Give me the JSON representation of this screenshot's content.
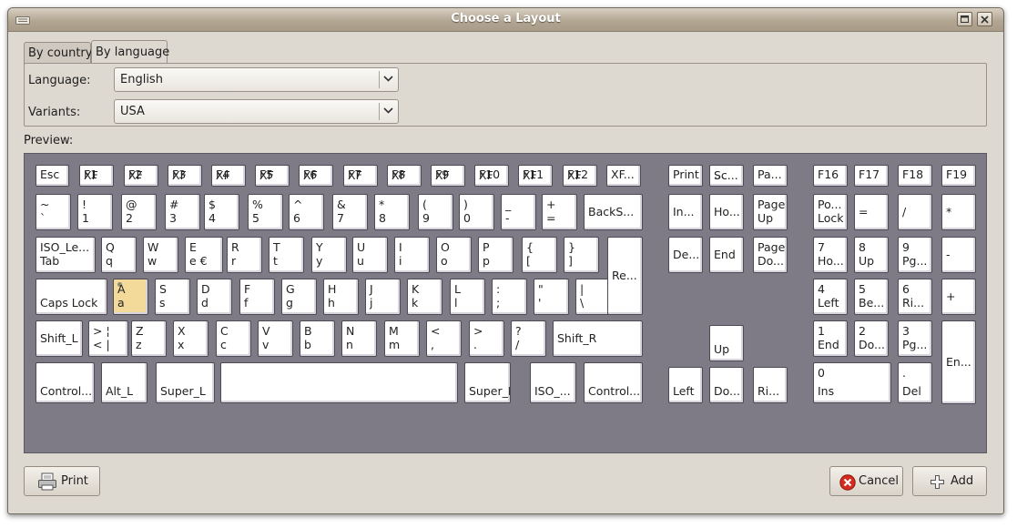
{
  "window": {
    "title": "Choose a Layout"
  },
  "tabs": [
    "By country",
    "By language"
  ],
  "form": {
    "language_label": "Language:",
    "language_value": "English",
    "variants_label": "Variants:",
    "variants_value": "USA"
  },
  "preview_label": "Preview:",
  "buttons": {
    "print": "Print",
    "cancel": "Cancel",
    "add": "Add"
  },
  "keyboard": {
    "keys": [
      {
        "t": "",
        "b": "Esc"
      },
      {
        "t": "XF",
        "b": "F1"
      },
      {
        "t": "XF",
        "b": "F2"
      },
      {
        "t": "XF",
        "b": "F3"
      },
      {
        "t": "XF",
        "b": "F4"
      },
      {
        "t": "XF",
        "b": "F5"
      },
      {
        "t": "XF",
        "b": "F6"
      },
      {
        "t": "XF",
        "b": "F7"
      },
      {
        "t": "XF",
        "b": "F8"
      },
      {
        "t": "XF",
        "b": "F9"
      },
      {
        "t": "XF",
        "b": "F10"
      },
      {
        "t": "XF",
        "b": "F11"
      },
      {
        "t": "XF",
        "b": "F12"
      },
      {
        "t": "",
        "b": "XF..."
      },
      {
        "t": "",
        "b": "Print"
      },
      {
        "t": "Sc...",
        "b": "..."
      },
      {
        "t": "",
        "b": "Pa..."
      },
      {
        "t": "",
        "b": "F16"
      },
      {
        "t": "",
        "b": "F17"
      },
      {
        "t": "",
        "b": "F18"
      },
      {
        "t": "",
        "b": "F19"
      },
      {
        "t": "~",
        "b": "`"
      },
      {
        "t": "!",
        "b": "1"
      },
      {
        "t": "@",
        "b": "2"
      },
      {
        "t": "#",
        "b": "3"
      },
      {
        "t": "$",
        "b": "4"
      },
      {
        "t": "%",
        "b": "5"
      },
      {
        "t": "^",
        "b": "6"
      },
      {
        "t": "&",
        "b": "7"
      },
      {
        "t": "*",
        "b": "8"
      },
      {
        "t": "(",
        "b": "9"
      },
      {
        "t": ")",
        "b": "0"
      },
      {
        "t": "_",
        "b": "-"
      },
      {
        "t": "+",
        "b": "="
      },
      {
        "t": "",
        "m": "BackS..."
      },
      {
        "t": "",
        "m": "In..."
      },
      {
        "t": "",
        "m": "Ho..."
      },
      {
        "t": "Page",
        "b": "Up"
      },
      {
        "t": "Po...",
        "b": "Lock"
      },
      {
        "t": "",
        "m": "="
      },
      {
        "t": "",
        "m": "/"
      },
      {
        "t": "",
        "m": "*"
      },
      {
        "t": "ISO_Le...",
        "b": "Tab"
      },
      {
        "t": "Q",
        "b": "q"
      },
      {
        "t": "W",
        "b": "w"
      },
      {
        "t": "E",
        "b": "e  €"
      },
      {
        "t": "R",
        "b": "r"
      },
      {
        "t": "T",
        "b": "t"
      },
      {
        "t": "Y",
        "b": "y"
      },
      {
        "t": "U",
        "b": "u"
      },
      {
        "t": "I",
        "b": "i"
      },
      {
        "t": "O",
        "b": "o"
      },
      {
        "t": "P",
        "b": "p"
      },
      {
        "t": "{",
        "b": "["
      },
      {
        "t": "}",
        "b": "]"
      },
      {
        "t": "",
        "m": "De..."
      },
      {
        "t": "",
        "m": "End"
      },
      {
        "t": "Page",
        "b": "Do..."
      },
      {
        "t": "7",
        "b": "Ho..."
      },
      {
        "t": "8",
        "b": "Up"
      },
      {
        "t": "9",
        "b": "Pg..."
      },
      {
        "t": "",
        "m": "-"
      },
      {
        "t": "",
        "b": "Caps Lock"
      },
      {
        "t": "A",
        "b": "a"
      },
      {
        "t": "S",
        "b": "s"
      },
      {
        "t": "D",
        "b": "d"
      },
      {
        "t": "F",
        "b": "f"
      },
      {
        "t": "G",
        "b": "g"
      },
      {
        "t": "H",
        "b": "h"
      },
      {
        "t": "J",
        "b": "j"
      },
      {
        "t": "K",
        "b": "k"
      },
      {
        "t": "L",
        "b": "l"
      },
      {
        "t": ":",
        "b": ";"
      },
      {
        "t": "\"",
        "b": "'"
      },
      {
        "t": "|",
        "b": "\\"
      },
      {
        "t": "",
        "m": "Re..."
      },
      {
        "t": "4",
        "b": "Left"
      },
      {
        "t": "5",
        "b": "Be..."
      },
      {
        "t": "6",
        "b": "Ri..."
      },
      {
        "t": "",
        "m": "+"
      },
      {
        "t": "",
        "m": "Shift_L"
      },
      {
        "t": ">  ¦",
        "b": "<  |"
      },
      {
        "t": "Z",
        "b": "z"
      },
      {
        "t": "X",
        "b": "x"
      },
      {
        "t": "C",
        "b": "c"
      },
      {
        "t": "V",
        "b": "v"
      },
      {
        "t": "B",
        "b": "b"
      },
      {
        "t": "N",
        "b": "n"
      },
      {
        "t": "M",
        "b": "m"
      },
      {
        "t": "<",
        "b": ","
      },
      {
        "t": ">",
        "b": "."
      },
      {
        "t": "?",
        "b": "/"
      },
      {
        "t": "",
        "m": "Shift_R"
      },
      {
        "t": "",
        "b": "Up"
      },
      {
        "t": "1",
        "b": "End"
      },
      {
        "t": "2",
        "b": "Do..."
      },
      {
        "t": "3",
        "b": "Pg..."
      },
      {
        "t": "",
        "m": "En..."
      },
      {
        "t": "",
        "b": "Control..."
      },
      {
        "t": "",
        "b": "Alt_L"
      },
      {
        "t": "",
        "b": "Super_L"
      },
      {
        "t": "",
        "b": ""
      },
      {
        "t": "",
        "b": "Super_R"
      },
      {
        "t": "",
        "b": "ISO_..."
      },
      {
        "t": "",
        "b": "Control..."
      },
      {
        "t": "",
        "b": "Left"
      },
      {
        "t": "",
        "b": "Do..."
      },
      {
        "t": "",
        "b": "Ri..."
      },
      {
        "t": "0",
        "b": "Ins"
      },
      {
        "t": ".",
        "b": "Del"
      }
    ]
  }
}
